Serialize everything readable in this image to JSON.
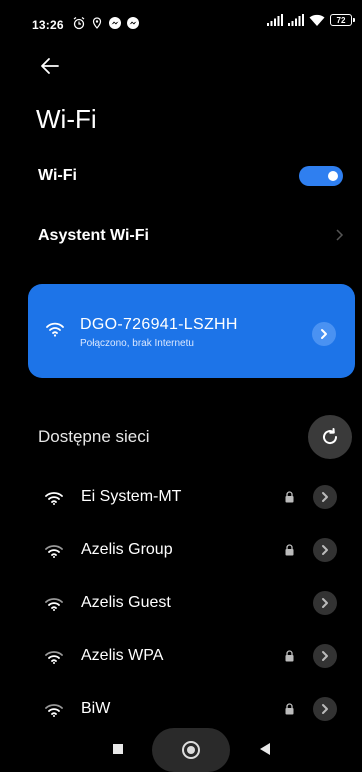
{
  "status_bar": {
    "time": "13:26",
    "battery": "72",
    "left_icons": [
      "alarm-icon",
      "location-icon",
      "messenger-icon",
      "messenger-icon"
    ],
    "right_icons": [
      "signal-icon",
      "signal-icon",
      "wifi-icon",
      "battery-icon"
    ]
  },
  "header": {
    "back_icon": "back-arrow-icon",
    "title": "Wi-Fi"
  },
  "settings": {
    "wifi_label": "Wi-Fi",
    "wifi_enabled": true,
    "assistant_label": "Asystent Wi-Fi"
  },
  "connected_network": {
    "name": "DGO-726941-LSZHH",
    "status": "Połączono, brak Internetu"
  },
  "available": {
    "title": "Dostępne sieci",
    "networks": [
      {
        "name": "Ei System-MT",
        "locked": true
      },
      {
        "name": "Azelis Group",
        "locked": true
      },
      {
        "name": "Azelis Guest",
        "locked": false
      },
      {
        "name": "Azelis WPA",
        "locked": true
      },
      {
        "name": "BiW",
        "locked": true
      }
    ]
  },
  "colors": {
    "accent": "#1d74e8",
    "toggle_on": "#2f7ff0",
    "background": "#000000"
  }
}
